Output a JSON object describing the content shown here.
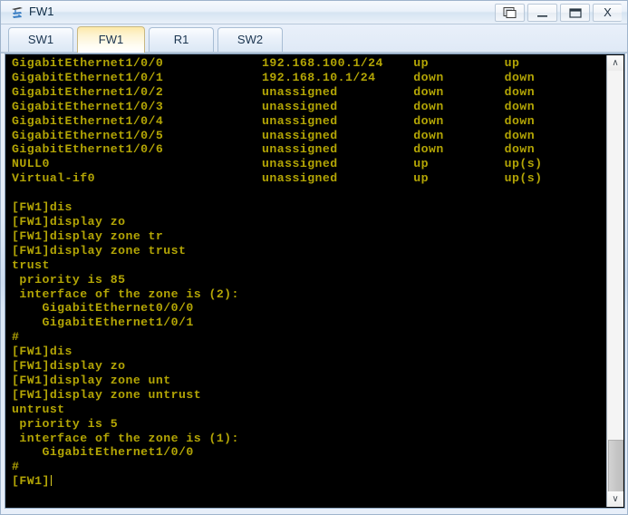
{
  "window": {
    "title": "FW1",
    "icon": "ensp-device-icon",
    "controls": {
      "restore_label": "restore-icon",
      "minimize_label": "–",
      "maximize_label": "▭",
      "close_label": "X"
    }
  },
  "tabs": [
    {
      "label": "SW1",
      "active": false
    },
    {
      "label": "FW1",
      "active": true
    },
    {
      "label": "R1",
      "active": false
    },
    {
      "label": "SW2",
      "active": false
    }
  ],
  "terminal": {
    "interface_table": [
      {
        "interface": "GigabitEthernet1/0/0",
        "ip": "192.168.100.1/24",
        "physical": "up",
        "protocol": "up"
      },
      {
        "interface": "GigabitEthernet1/0/1",
        "ip": "192.168.10.1/24",
        "physical": "down",
        "protocol": "down"
      },
      {
        "interface": "GigabitEthernet1/0/2",
        "ip": "unassigned",
        "physical": "down",
        "protocol": "down"
      },
      {
        "interface": "GigabitEthernet1/0/3",
        "ip": "unassigned",
        "physical": "down",
        "protocol": "down"
      },
      {
        "interface": "GigabitEthernet1/0/4",
        "ip": "unassigned",
        "physical": "down",
        "protocol": "down"
      },
      {
        "interface": "GigabitEthernet1/0/5",
        "ip": "unassigned",
        "physical": "down",
        "protocol": "down"
      },
      {
        "interface": "GigabitEthernet1/0/6",
        "ip": "unassigned",
        "physical": "down",
        "protocol": "down"
      },
      {
        "interface": "NULL0",
        "ip": "unassigned",
        "physical": "up",
        "protocol": "up(s)"
      },
      {
        "interface": "Virtual-if0",
        "ip": "unassigned",
        "physical": "up",
        "protocol": "up(s)"
      }
    ],
    "session_lines": [
      "[FW1]dis",
      "[FW1]display zo",
      "[FW1]display zone tr",
      "[FW1]display zone trust",
      "trust",
      " priority is 85",
      " interface of the zone is (2):",
      "    GigabitEthernet0/0/0",
      "    GigabitEthernet1/0/1",
      "#",
      "[FW1]dis",
      "[FW1]display zo",
      "[FW1]display zone unt",
      "[FW1]display zone untrust",
      "untrust",
      " priority is 5",
      " interface of the zone is (1):",
      "    GigabitEthernet1/0/0",
      "#",
      "[FW1]"
    ],
    "prompt": "[FW1]",
    "text_color": "#b3a505",
    "background_color": "#000000"
  },
  "scrollbar": {
    "up_arrow": "∧",
    "down_arrow": "∨"
  }
}
